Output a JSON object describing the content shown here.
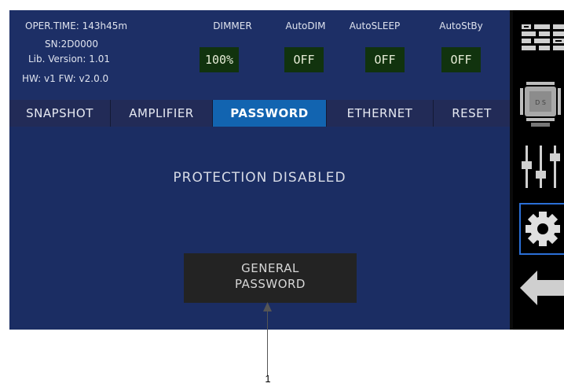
{
  "header": {
    "oper_time": "OPER.TIME: 143h45m",
    "sn": "SN:2D0000",
    "lib_version": "Lib. Version: 1.01",
    "hw_fw": "HW: v1  FW: v2.0.0",
    "controls": [
      {
        "label": "DIMMER",
        "value": "100%"
      },
      {
        "label": "AutoDIM",
        "value": "OFF"
      },
      {
        "label": "AutoSLEEP",
        "value": "OFF"
      },
      {
        "label": "AutoStBy",
        "value": "OFF"
      }
    ]
  },
  "tabs": [
    {
      "label": "SNAPSHOT",
      "active": false
    },
    {
      "label": "AMPLIFIER",
      "active": false
    },
    {
      "label": "PASSWORD",
      "active": true
    },
    {
      "label": "ETHERNET",
      "active": false
    },
    {
      "label": "RESET",
      "active": false
    }
  ],
  "main": {
    "status": "PROTECTION DISABLED",
    "button_line1": "GENERAL",
    "button_line2": "PASSWORD"
  },
  "sidebar": {
    "items": [
      {
        "icon": "grid-icon"
      },
      {
        "icon": "chip-icon"
      },
      {
        "icon": "sliders-icon"
      },
      {
        "icon": "gear-icon",
        "selected": true
      },
      {
        "icon": "back-arrow-icon"
      }
    ],
    "back_label": "BACK"
  },
  "callout": "1",
  "colors": {
    "panel": "#1b2d63",
    "tab_active": "#1264b0",
    "value_box": "#11330e",
    "sidebar": "#000000",
    "selected_outline": "#2b6fd6"
  }
}
